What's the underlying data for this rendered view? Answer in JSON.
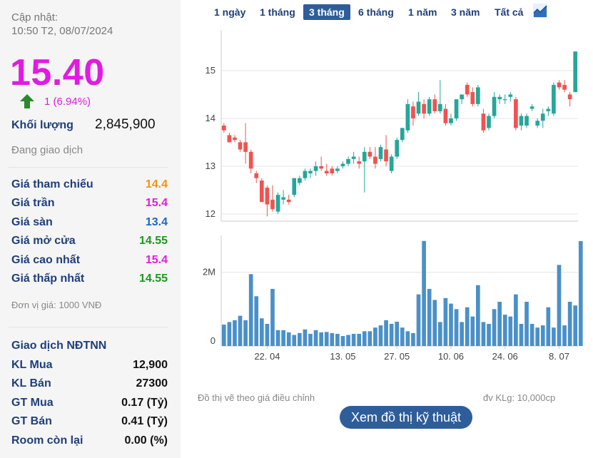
{
  "summary": {
    "update_label": "Cập nhật:",
    "update_time": "10:50 T2, 08/07/2024",
    "price": "15.40",
    "change": "1 (6.94%)",
    "volume_label": "Khối lượng",
    "volume_value": "2,845,900",
    "status": "Đang giao dịch"
  },
  "prices": [
    {
      "label": "Giá tham chiếu",
      "value": "14.4",
      "color": "#f0960c"
    },
    {
      "label": "Giá trần",
      "value": "15.4",
      "color": "#e11be1"
    },
    {
      "label": "Giá sàn",
      "value": "13.4",
      "color": "#1e64c8"
    },
    {
      "label": "Giá mở cửa",
      "value": "14.55",
      "color": "#1a9a1a"
    },
    {
      "label": "Giá cao nhất",
      "value": "15.4",
      "color": "#e11be1"
    },
    {
      "label": "Giá thấp nhất",
      "value": "14.55",
      "color": "#1a9a1a"
    }
  ],
  "unit_note": "Đơn vị giá: 1000 VNĐ",
  "foreign": {
    "title": "Giao dịch NĐTNN",
    "rows": [
      {
        "label": "KL Mua",
        "value": "12,900"
      },
      {
        "label": "KL Bán",
        "value": "27300"
      },
      {
        "label": "GT Mua",
        "value": "0.17 (Tỷ)"
      },
      {
        "label": "GT Bán",
        "value": "0.41 (Tỷ)"
      },
      {
        "label": "Room còn lại",
        "value": "0.00 (%)"
      }
    ]
  },
  "tabs": [
    "1 ngày",
    "1 tháng",
    "3 tháng",
    "6 tháng",
    "1 năm",
    "3 năm",
    "Tất cả"
  ],
  "active_tab": 2,
  "footer": {
    "note": "Đồ thị vẽ theo giá điều chỉnh",
    "unit": "đv KLg: 10,000cp",
    "button": "Xem đồ thị kỹ thuật"
  },
  "colors": {
    "up": "#26a69a",
    "down": "#ef5350",
    "volume": "#4a90c8",
    "accent": "#2e5d9a",
    "price": "#e11be1"
  },
  "chart_data": {
    "type": "candlestick",
    "price_axis": {
      "ticks": [
        12,
        13,
        14,
        15
      ],
      "ylim": [
        11.85,
        15.85
      ]
    },
    "volume_axis": {
      "ticks": [
        0,
        2000000
      ],
      "tick_labels": [
        "0",
        "2M"
      ],
      "ylim": [
        0,
        3000000
      ]
    },
    "x_tick_labels": [
      {
        "label": "22. 04",
        "index": 8
      },
      {
        "label": "13. 05",
        "index": 22
      },
      {
        "label": "27. 05",
        "index": 32
      },
      {
        "label": "10. 06",
        "index": 42
      },
      {
        "label": "24. 06",
        "index": 52
      },
      {
        "label": "8. 07",
        "index": 62
      }
    ],
    "candles": [
      [
        13.85,
        13.9,
        13.7,
        13.75
      ],
      [
        13.65,
        13.7,
        13.5,
        13.5
      ],
      [
        13.6,
        13.65,
        13.5,
        13.55
      ],
      [
        13.5,
        13.55,
        13.3,
        13.35
      ],
      [
        13.5,
        13.9,
        13.05,
        13.3
      ],
      [
        13.3,
        13.35,
        12.85,
        12.95
      ],
      [
        12.85,
        12.9,
        12.65,
        12.75
      ],
      [
        12.7,
        12.75,
        12.25,
        12.25
      ],
      [
        12.55,
        12.6,
        11.95,
        12.2
      ],
      [
        12.3,
        12.6,
        12.05,
        12.1
      ],
      [
        12.05,
        12.45,
        12.0,
        12.4
      ],
      [
        12.3,
        12.5,
        12.2,
        12.35
      ],
      [
        12.3,
        12.4,
        12.2,
        12.25
      ],
      [
        12.4,
        12.75,
        12.35,
        12.75
      ],
      [
        12.65,
        12.8,
        12.6,
        12.75
      ],
      [
        12.75,
        12.95,
        12.7,
        12.9
      ],
      [
        12.85,
        12.95,
        12.75,
        12.9
      ],
      [
        12.9,
        13.1,
        12.8,
        13.0
      ],
      [
        13.0,
        13.2,
        12.9,
        12.95
      ],
      [
        12.9,
        13.05,
        12.8,
        12.85
      ],
      [
        12.95,
        13.0,
        12.8,
        12.85
      ],
      [
        12.9,
        13.0,
        12.85,
        12.95
      ],
      [
        13.0,
        13.1,
        12.95,
        13.05
      ],
      [
        13.05,
        13.2,
        13.0,
        13.15
      ],
      [
        13.15,
        13.3,
        13.05,
        13.2
      ],
      [
        13.1,
        13.2,
        12.95,
        13.05
      ],
      [
        13.1,
        13.4,
        12.45,
        13.3
      ],
      [
        13.3,
        13.4,
        13.15,
        13.2
      ],
      [
        13.2,
        13.4,
        12.95,
        13.05
      ],
      [
        13.15,
        13.45,
        13.1,
        13.4
      ],
      [
        13.35,
        13.65,
        13.0,
        13.1
      ],
      [
        12.9,
        13.25,
        12.85,
        13.2
      ],
      [
        13.2,
        13.6,
        13.15,
        13.55
      ],
      [
        13.55,
        13.8,
        13.5,
        13.8
      ],
      [
        13.75,
        14.4,
        13.7,
        14.3
      ],
      [
        14.25,
        14.35,
        13.85,
        14.0
      ],
      [
        14.1,
        14.55,
        14.05,
        14.35
      ],
      [
        14.3,
        14.4,
        14.0,
        14.1
      ],
      [
        14.1,
        14.45,
        14.05,
        14.4
      ],
      [
        14.4,
        14.5,
        14.1,
        14.15
      ],
      [
        14.15,
        14.8,
        14.1,
        14.3
      ],
      [
        14.2,
        14.3,
        13.85,
        13.9
      ],
      [
        13.9,
        14.1,
        13.85,
        14.0
      ],
      [
        14.0,
        14.4,
        13.95,
        14.4
      ],
      [
        14.4,
        14.5,
        14.3,
        14.5
      ],
      [
        14.7,
        14.75,
        14.45,
        14.5
      ],
      [
        14.55,
        14.65,
        14.25,
        14.3
      ],
      [
        14.3,
        14.7,
        14.25,
        14.65
      ],
      [
        14.1,
        14.2,
        13.7,
        13.75
      ],
      [
        13.8,
        14.1,
        13.75,
        14.05
      ],
      [
        14.05,
        14.55,
        14.0,
        14.45
      ],
      [
        14.4,
        14.5,
        14.3,
        14.45
      ],
      [
        14.4,
        14.5,
        14.3,
        14.4
      ],
      [
        14.45,
        14.55,
        14.35,
        14.5
      ],
      [
        14.4,
        14.45,
        13.75,
        13.8
      ],
      [
        13.85,
        14.1,
        13.75,
        14.05
      ],
      [
        13.85,
        14.1,
        13.8,
        14.05
      ],
      [
        14.2,
        14.3,
        14.15,
        14.25
      ],
      [
        13.85,
        14.0,
        13.8,
        13.95
      ],
      [
        13.95,
        14.2,
        13.8,
        14.1
      ],
      [
        14.15,
        14.25,
        14.05,
        14.2
      ],
      [
        14.1,
        14.75,
        14.05,
        14.7
      ],
      [
        14.75,
        14.8,
        14.6,
        14.65
      ],
      [
        14.7,
        14.8,
        14.55,
        14.6
      ],
      [
        14.5,
        14.55,
        14.25,
        14.4
      ],
      [
        14.55,
        15.4,
        14.55,
        15.4
      ]
    ],
    "volumes": [
      580000,
      650000,
      700000,
      820000,
      700000,
      1950000,
      1350000,
      750000,
      600000,
      1550000,
      430000,
      430000,
      370000,
      300000,
      350000,
      450000,
      330000,
      430000,
      370000,
      380000,
      350000,
      330000,
      270000,
      300000,
      330000,
      330000,
      400000,
      400000,
      500000,
      560000,
      700000,
      600000,
      660000,
      500000,
      400000,
      350000,
      1400000,
      2850000,
      1550000,
      1250000,
      650000,
      1300000,
      1150000,
      1000000,
      650000,
      1050000,
      800000,
      1650000,
      650000,
      600000,
      1000000,
      1200000,
      850000,
      800000,
      1400000,
      600000,
      1200000,
      600000,
      500000,
      560000,
      1050000,
      500000,
      2200000,
      560000,
      1200000,
      1100000,
      2845900
    ]
  }
}
